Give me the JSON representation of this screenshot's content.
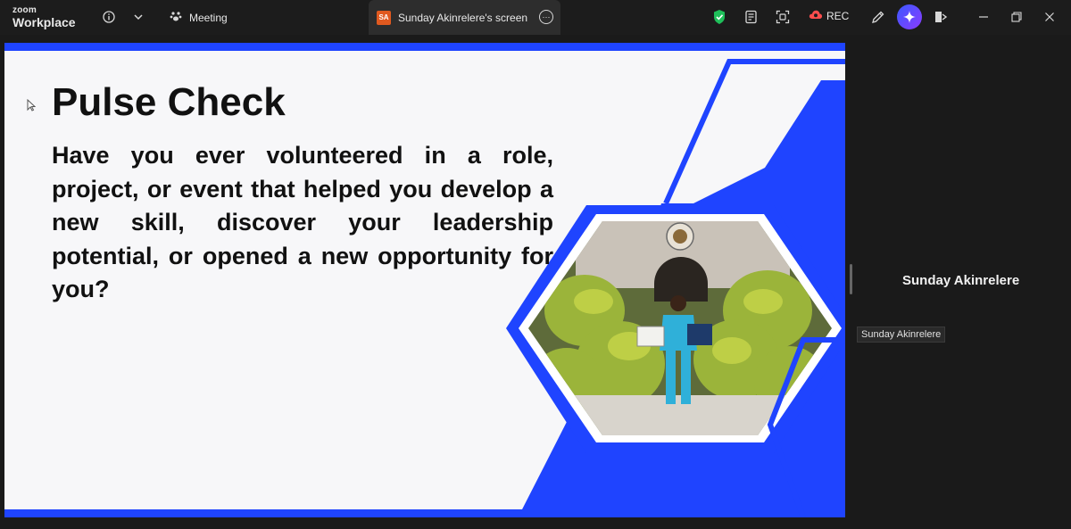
{
  "app": {
    "logo_small": "zoom",
    "logo_big": "Workplace"
  },
  "titlebar": {
    "meeting_tab_label": "Meeting",
    "share_badge": "SA",
    "share_tab_label": "Sunday Akinrelere's screen",
    "rec_label": "REC",
    "icons": [
      "info-icon",
      "chevron-down-icon",
      "paw-icon",
      "more-icon",
      "shield-icon",
      "notes-icon",
      "frame-icon",
      "cloud-rec-icon",
      "annotate-icon",
      "ai-companion-icon",
      "leave-icon",
      "minimize-icon",
      "restore-icon",
      "close-icon"
    ]
  },
  "slide": {
    "title": "Pulse Check",
    "body": "Have you ever volunteered in a role, project, or event that helped you develop a new skill, discover your leadership potential, or opened a new opportunity for you?",
    "accent_color": "#1f44ff"
  },
  "participant": {
    "name": "Sunday Akinrelere",
    "name_tag": "Sunday Akinrelere"
  }
}
